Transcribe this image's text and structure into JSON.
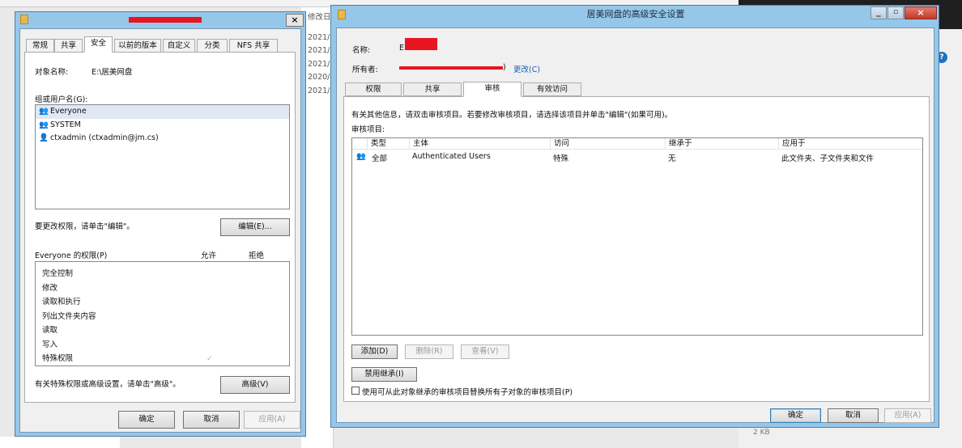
{
  "background": {
    "modified_header": "修改日",
    "dates": [
      "2021/",
      "2021/",
      "2021/",
      "2020/",
      "2021/"
    ],
    "size_text": "2 KB"
  },
  "props": {
    "title": "",
    "tabs": [
      "常规",
      "共享",
      "安全",
      "以前的版本",
      "自定义",
      "分类",
      "NFS 共享"
    ],
    "active_tab": "安全",
    "object_label": "对象名称:",
    "object_value": "E:\\居美网盘",
    "group_label": "组或用户名(G):",
    "users": [
      {
        "icon": "group-icon",
        "name": "Everyone"
      },
      {
        "icon": "group-icon",
        "name": "SYSTEM"
      },
      {
        "icon": "user-icon",
        "name": "ctxadmin (ctxadmin@jm.cs)"
      }
    ],
    "change_hint": "要更改权限，请单击\"编辑\"。",
    "edit_button": "编辑(E)...",
    "perm_header": "Everyone 的权限(P)",
    "allow_header": "允许",
    "deny_header": "拒绝",
    "permissions": [
      "完全控制",
      "修改",
      "读取和执行",
      "列出文件夹内容",
      "读取",
      "写入",
      "特殊权限"
    ],
    "special_check": "✓",
    "advanced_hint": "有关特殊权限或高级设置，请单击\"高级\"。",
    "advanced_button": "高级(V)",
    "ok_button": "确定",
    "cancel_button": "取消",
    "apply_button": "应用(A)"
  },
  "adv": {
    "title": "居美网盘的高级安全设置",
    "name_label": "名称:",
    "name_value": "E",
    "owner_label": "所有者:",
    "owner_suffix": ")",
    "change_link": "更改(C)",
    "tabs": [
      "权限",
      "共享",
      "审核",
      "有效访问"
    ],
    "active_tab": "审核",
    "info_text": "有关其他信息，请双击审核项目。若要修改审核项目，请选择该项目并单击\"编辑\"(如果可用)。",
    "items_label": "审核项目:",
    "columns": [
      "类型",
      "主体",
      "访问",
      "继承于",
      "应用于"
    ],
    "rows": [
      {
        "type": "全部",
        "principal": "Authenticated Users",
        "access": "特殊",
        "inherited": "无",
        "applies": "此文件夹、子文件夹和文件"
      }
    ],
    "add_button": "添加(D)",
    "remove_button": "删除(R)",
    "view_button": "查看(V)",
    "disable_inherit_button": "禁用继承(I)",
    "replace_label": "使用可从此对象继承的审核项目替换所有子对象的审核项目(P)",
    "ok_button": "确定",
    "cancel_button": "取消",
    "apply_button": "应用(A)"
  }
}
